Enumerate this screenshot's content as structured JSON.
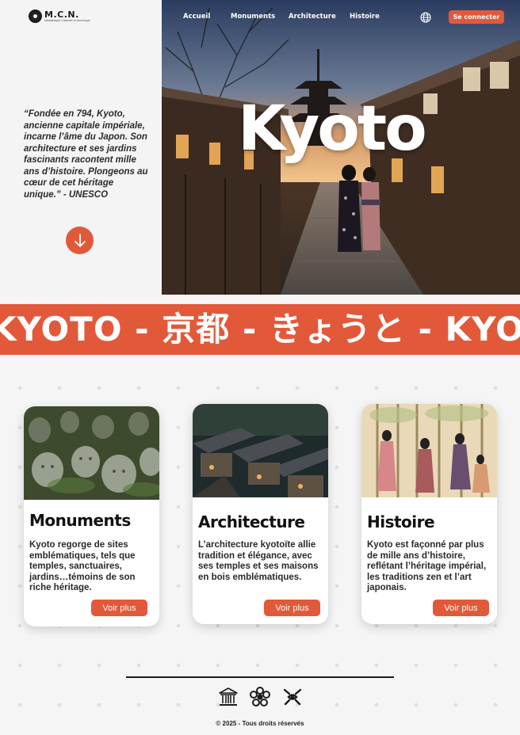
{
  "brand": {
    "name": "M.C.N.",
    "tagline": "Médiathèque Culturelle et Numérique"
  },
  "nav": {
    "items": [
      "Accueil",
      "Monuments",
      "Architecture",
      "Histoire"
    ],
    "language_icon": "globe-icon",
    "login_label": "Se connecter"
  },
  "hero": {
    "title": "Kyoto",
    "quote": "“Fondée en 794, Kyoto, ancienne capitale impériale, incarne l’âme du Japon. Son architecture et ses jardins fascinants racontent mille ans d’histoire. Plongeons au cœur de cet héritage unique.” - UNESCO",
    "scroll_icon": "arrow-down-icon"
  },
  "banner": {
    "text": "KYOTO - 京都 - きょうと - KYOTO"
  },
  "cards": [
    {
      "title": "Monuments",
      "text": "Kyoto regorge de sites emblématiques, tels que temples, sanctuaires, jardins…témoins de son riche héritage.",
      "button": "Voir plus"
    },
    {
      "title": "Architecture",
      "text": "L’architecture kyotoïte allie tradition et élégance, avec ses temples et ses maisons en bois emblématiques.",
      "button": "Voir plus"
    },
    {
      "title": "Histoire",
      "text": "Kyoto est façonné par plus de mille ans d’histoire, reflétant l’héritage impérial, les traditions zen et l’art japonais.",
      "button": "Voir plus"
    }
  ],
  "footer": {
    "icons": [
      "unesco-temple-icon",
      "kyoto-emblem-icon",
      "kyoto-city-seal-icon"
    ],
    "copyright": "© 2025 - Tous droits réservés"
  },
  "colors": {
    "accent": "#e2593a",
    "background": "#f5f5f5",
    "text": "#1a1a1a"
  }
}
